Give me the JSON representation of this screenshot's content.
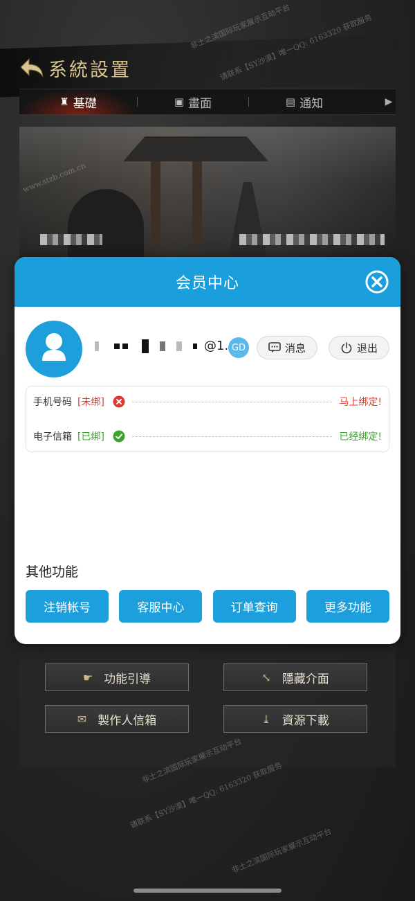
{
  "game": {
    "title": "系統設置",
    "tabs": [
      {
        "label": "基礎",
        "icon": "tower-icon"
      },
      {
        "label": "畫面",
        "icon": "screen-icon"
      },
      {
        "label": "通知",
        "icon": "chat-icon"
      }
    ],
    "buttons": [
      {
        "label": "功能引導",
        "icon": "hand-icon"
      },
      {
        "label": "隱藏介面",
        "icon": "resize-icon"
      },
      {
        "label": "製作人信箱",
        "icon": "mail-icon"
      },
      {
        "label": "資源下載",
        "icon": "download-icon"
      }
    ],
    "watermarks": [
      "非土之滨国际玩家展示互动平台",
      "www.stzb.com.cn",
      "请联系【SY沙漠】唯一QQ: 6163320 获取服务"
    ]
  },
  "modal": {
    "title": "会员中心",
    "username_suffix": "@1...",
    "badge": "GD",
    "message_label": "消息",
    "logout_label": "退出",
    "bindings": [
      {
        "label": "手机号码",
        "status": "[未绑]",
        "action": "马上绑定!",
        "state": "unbound"
      },
      {
        "label": "电子信箱",
        "status": "[已绑]",
        "action": "已经绑定!",
        "state": "bound"
      }
    ],
    "other_title": "其他功能",
    "functions": [
      "注销帐号",
      "客服中心",
      "订单查询",
      "更多功能"
    ]
  },
  "colors": {
    "accent": "#1b9fdc",
    "gold": "#d9c48e",
    "error": "#e03a2f",
    "success": "#3aa52f"
  }
}
